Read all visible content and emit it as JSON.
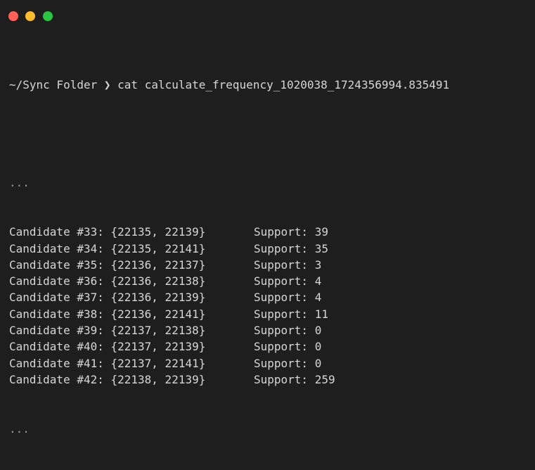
{
  "window": {
    "controls": [
      "close",
      "minimize",
      "zoom"
    ],
    "colors": {
      "background": "#1e1e1e",
      "text": "#d6d6d6",
      "close": "#ff5f57",
      "minimize": "#febc2e",
      "zoom": "#28c840"
    }
  },
  "prompt": {
    "path": "~/Sync Folder",
    "symbol": "❯",
    "command": "cat calculate_frequency_1020038_1724356994.835491"
  },
  "output": {
    "leading_ellipsis": "...",
    "trailing_ellipsis": "...",
    "rows": [
      {
        "candidate": "Candidate #33: {22135, 22139}",
        "support_label": "Support:",
        "support": "39"
      },
      {
        "candidate": "Candidate #34: {22135, 22141}",
        "support_label": "Support:",
        "support": "35"
      },
      {
        "candidate": "Candidate #35: {22136, 22137}",
        "support_label": "Support:",
        "support": "3"
      },
      {
        "candidate": "Candidate #36: {22136, 22138}",
        "support_label": "Support:",
        "support": "4"
      },
      {
        "candidate": "Candidate #37: {22136, 22139}",
        "support_label": "Support:",
        "support": "4"
      },
      {
        "candidate": "Candidate #38: {22136, 22141}",
        "support_label": "Support:",
        "support": "11"
      },
      {
        "candidate": "Candidate #39: {22137, 22138}",
        "support_label": "Support:",
        "support": "0"
      },
      {
        "candidate": "Candidate #40: {22137, 22139}",
        "support_label": "Support:",
        "support": "0"
      },
      {
        "candidate": "Candidate #41: {22137, 22141}",
        "support_label": "Support:",
        "support": "0"
      },
      {
        "candidate": "Candidate #42: {22138, 22139}",
        "support_label": "Support:",
        "support": "259"
      }
    ]
  }
}
